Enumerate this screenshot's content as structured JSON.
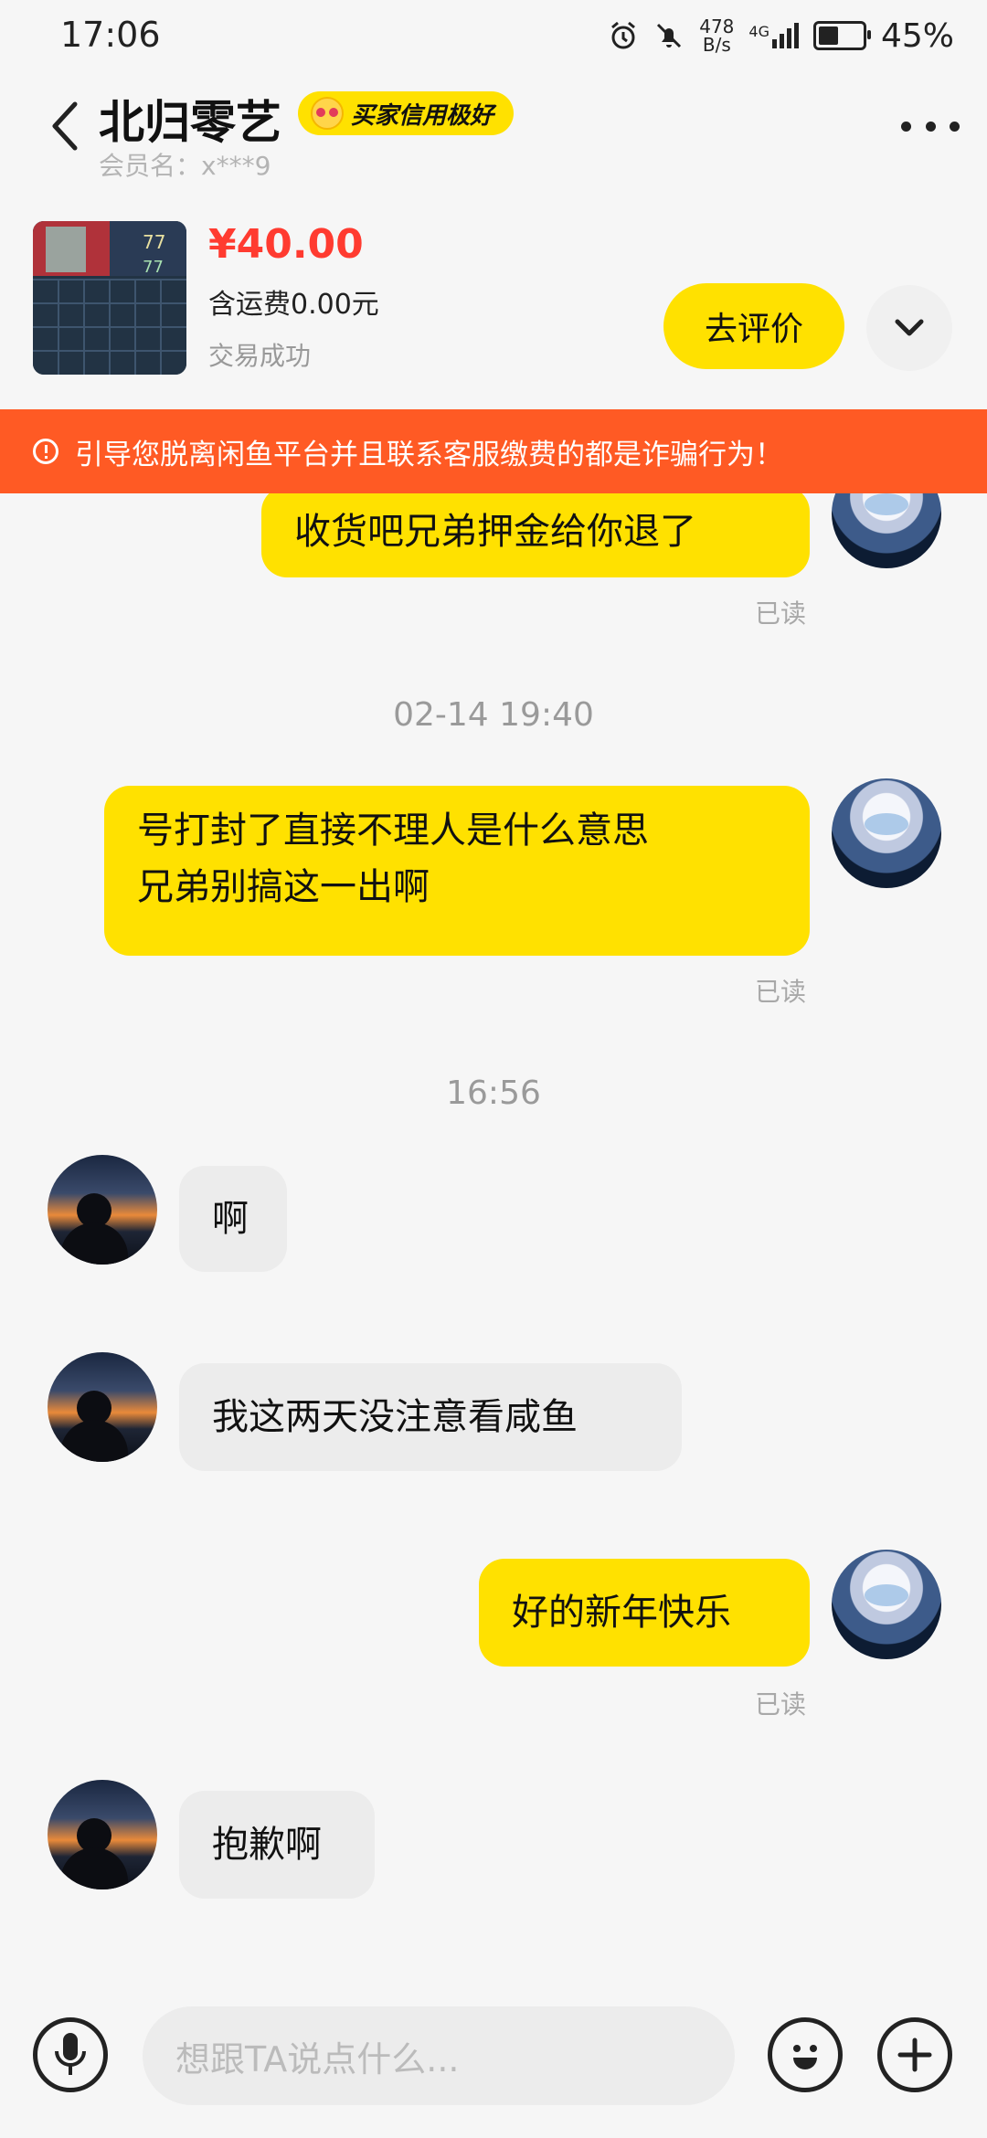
{
  "status_bar": {
    "time": "17:06",
    "net_speed_value": "478",
    "net_speed_unit": "B/s",
    "network": "4G",
    "battery": "45%",
    "battery_level": 0.45
  },
  "header": {
    "contact_name": "北归零艺",
    "credit_badge": "买家信用极好",
    "member_id": "会员名：x***9"
  },
  "product": {
    "price": "¥40.00",
    "shipping": "含运费0.00元",
    "status": "交易成功",
    "review_button": "去评价"
  },
  "warning": {
    "text": "引导您脱离闲鱼平台并且联系客服缴费的都是诈骗行为！"
  },
  "messages": [
    {
      "side": "me",
      "text": "收货吧兄弟押金给你退了",
      "read": "已读"
    },
    {
      "timestamp": "02-14 19:40"
    },
    {
      "side": "me",
      "line1": "号打封了直接不理人是什么意思",
      "line2": "兄弟别搞这一出啊",
      "read": "已读"
    },
    {
      "timestamp": "16:56"
    },
    {
      "side": "them",
      "text": "啊"
    },
    {
      "side": "them",
      "text": "我这两天没注意看咸鱼"
    },
    {
      "side": "me",
      "text": "好的新年快乐",
      "read": "已读"
    },
    {
      "side": "them",
      "text": "抱歉啊"
    }
  ],
  "input": {
    "placeholder": "想跟TA说点什么..."
  },
  "icons": {
    "back": "chevron-left-icon",
    "more": "more-dots-icon",
    "expand": "chevron-down-icon",
    "voice": "microphone-icon",
    "emoji": "emoji-icon",
    "add": "plus-icon",
    "warning": "warning-circle-icon"
  },
  "colors": {
    "accent": "#ffe100",
    "price": "#ff3b30",
    "warning_bg": "#ff5a24"
  }
}
